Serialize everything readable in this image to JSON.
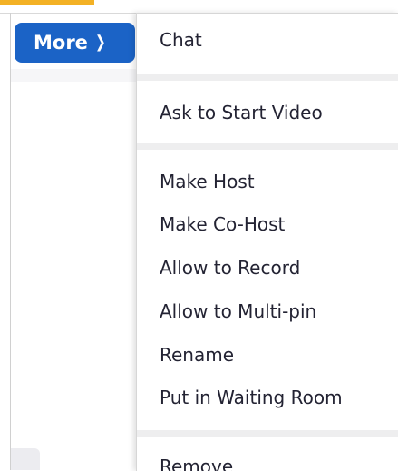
{
  "more_button": {
    "label": "More",
    "icon": "chevron-right-icon"
  },
  "menu": {
    "items": [
      {
        "label": "Chat"
      },
      {
        "label": "Ask to Start Video"
      },
      {
        "label": "Make Host"
      },
      {
        "label": "Make Co-Host"
      },
      {
        "label": "Allow to Record"
      },
      {
        "label": "Allow to Multi-pin"
      },
      {
        "label": "Rename"
      },
      {
        "label": "Put in Waiting Room"
      },
      {
        "label": "Remove"
      }
    ]
  },
  "colors": {
    "accent": "#1b63c6",
    "highlight": "#f3b125",
    "text": "#232333",
    "divider": "#eeeeef"
  }
}
